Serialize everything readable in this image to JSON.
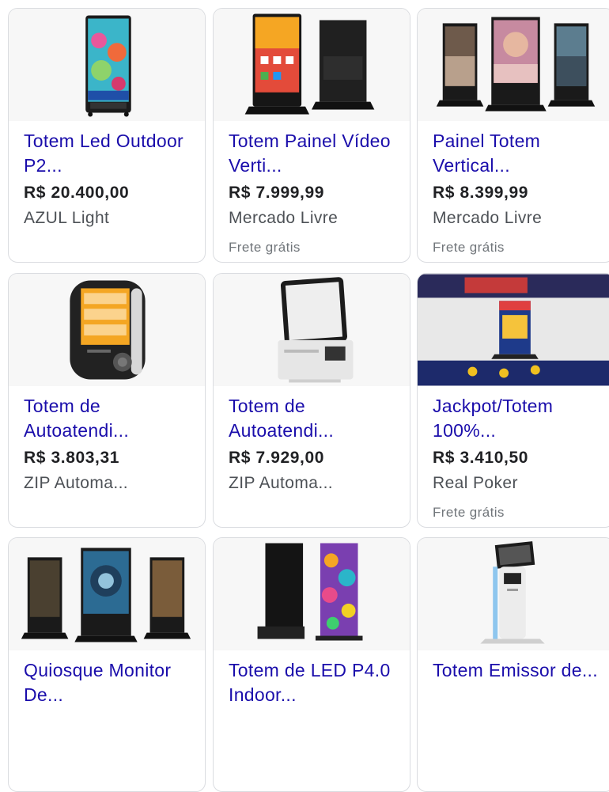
{
  "products": [
    {
      "title": "Totem Led Outdoor P2...",
      "price": "R$ 20.400,00",
      "seller": "AZUL Light",
      "shipping": "",
      "image_icon": "led-totem-image"
    },
    {
      "title": "Totem Painel Vídeo Verti...",
      "price": "R$ 7.999,99",
      "seller": "Mercado Livre",
      "shipping": "Frete grátis",
      "image_icon": "video-panel-totem-image"
    },
    {
      "title": "Painel Totem Vertical...",
      "price": "R$ 8.399,99",
      "seller": "Mercado Livre",
      "shipping": "Frete grátis",
      "image_icon": "vertical-panel-totem-image"
    },
    {
      "title": "Totem de Autoatendi...",
      "price": "R$ 3.803,31",
      "seller": "ZIP Automa...",
      "shipping": "",
      "image_icon": "self-service-kiosk-image"
    },
    {
      "title": "Totem de Autoatendi...",
      "price": "R$ 7.929,00",
      "seller": "ZIP Automa...",
      "shipping": "",
      "image_icon": "white-kiosk-image"
    },
    {
      "title": "Jackpot/Totem 100%...",
      "price": "R$ 3.410,50",
      "seller": "Real Poker",
      "shipping": "Frete grátis",
      "image_icon": "jackpot-totem-image"
    },
    {
      "title": "Quiosque Monitor De...",
      "price": "",
      "seller": "",
      "shipping": "",
      "image_icon": "monitor-kiosk-image"
    },
    {
      "title": "Totem de LED P4.0 Indoor...",
      "price": "",
      "seller": "",
      "shipping": "",
      "image_icon": "led-p4-totem-image"
    },
    {
      "title": "Totem Emissor de...",
      "price": "",
      "seller": "",
      "shipping": "",
      "image_icon": "ticket-emitter-totem-image"
    }
  ],
  "colors": {
    "title_link": "#1a0dab",
    "price": "#202124",
    "seller": "#4d5156",
    "shipping": "#70757a",
    "border": "#dadce0"
  }
}
